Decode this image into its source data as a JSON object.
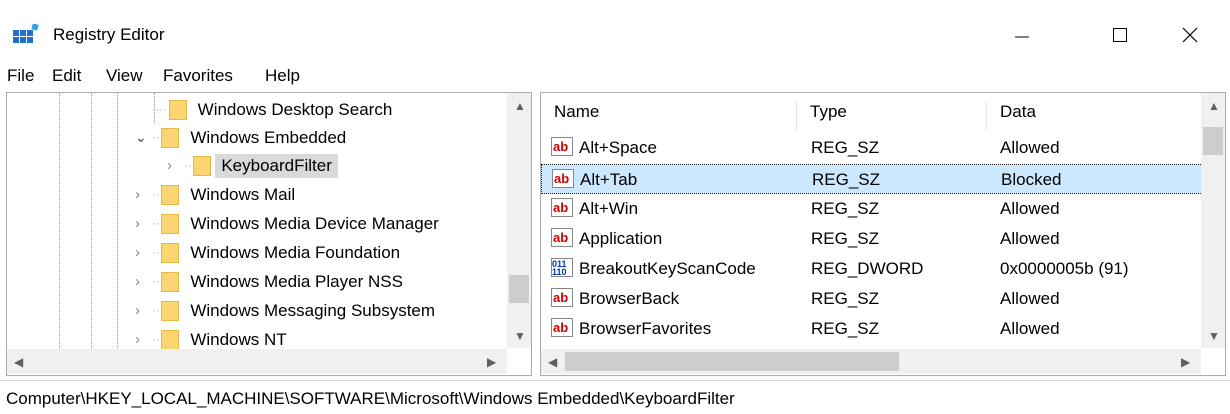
{
  "window": {
    "title": "Registry Editor"
  },
  "menu": [
    {
      "label": "File"
    },
    {
      "label": "Edit"
    },
    {
      "label": "View"
    },
    {
      "label": "Favorites"
    },
    {
      "label": "Help"
    }
  ],
  "tree": [
    {
      "label": "Windows Desktop Search",
      "expander": "none",
      "selected": false
    },
    {
      "label": "Windows Embedded",
      "expander": "expanded",
      "selected": false
    },
    {
      "label": "KeyboardFilter",
      "expander": "collapsed",
      "selected": true
    },
    {
      "label": "Windows Mail",
      "expander": "collapsed",
      "selected": false
    },
    {
      "label": "Windows Media Device Manager",
      "expander": "collapsed",
      "selected": false
    },
    {
      "label": "Windows Media Foundation",
      "expander": "collapsed",
      "selected": false
    },
    {
      "label": "Windows Media Player NSS",
      "expander": "collapsed",
      "selected": false
    },
    {
      "label": "Windows Messaging Subsystem",
      "expander": "collapsed",
      "selected": false
    },
    {
      "label": "Windows NT",
      "expander": "collapsed",
      "selected": false
    }
  ],
  "columns": {
    "name": "Name",
    "type": "Type",
    "data": "Data"
  },
  "values": [
    {
      "name": "Alt+Space",
      "type": "REG_SZ",
      "data": "Allowed",
      "icon": "string-value-icon",
      "badge": "ab"
    },
    {
      "name": "Alt+Tab",
      "type": "REG_SZ",
      "data": "Blocked",
      "icon": "string-value-icon",
      "badge": "ab"
    },
    {
      "name": "Alt+Win",
      "type": "REG_SZ",
      "data": "Allowed",
      "icon": "string-value-icon",
      "badge": "ab"
    },
    {
      "name": "Application",
      "type": "REG_SZ",
      "data": "Allowed",
      "icon": "string-value-icon",
      "badge": "ab"
    },
    {
      "name": "BreakoutKeyScanCode",
      "type": "REG_DWORD",
      "data": "0x0000005b (91)",
      "icon": "binary-value-icon",
      "badge": "011\n110"
    },
    {
      "name": "BrowserBack",
      "type": "REG_SZ",
      "data": "Allowed",
      "icon": "string-value-icon",
      "badge": "ab"
    },
    {
      "name": "BrowserFavorites",
      "type": "REG_SZ",
      "data": "Allowed",
      "icon": "string-value-icon",
      "badge": "ab"
    }
  ],
  "status": {
    "path": "Computer\\HKEY_LOCAL_MACHINE\\SOFTWARE\\Microsoft\\Windows Embedded\\KeyboardFilter"
  },
  "colors": {
    "selection": "#cce8ff",
    "tree_selection": "#d9d9d9",
    "folder": "#fbd572"
  }
}
